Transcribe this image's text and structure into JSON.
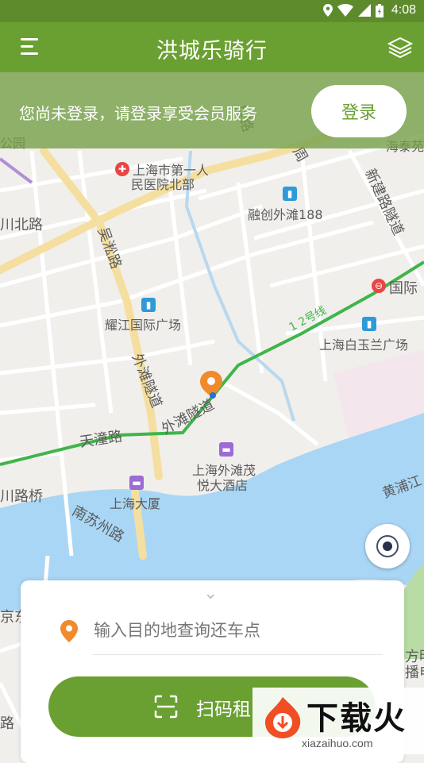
{
  "status_bar": {
    "time": "4:08"
  },
  "header": {
    "title": "洪城乐骑行",
    "menu_icon": "menu-icon",
    "layers_icon": "layers-icon"
  },
  "login_banner": {
    "message": "您尚未登录，请登录享受会员服务",
    "button_label": "登录"
  },
  "map": {
    "labels": [
      {
        "text": "公园",
        "name": "map-label-park"
      },
      {
        "text": "上海市第一人",
        "name": "map-label-hospital-1"
      },
      {
        "text": "民医院北部",
        "name": "map-label-hospital-2"
      },
      {
        "text": "融创外滩188",
        "name": "map-label-rongchuang"
      },
      {
        "text": "川北路",
        "name": "map-label-chuanbei-road"
      },
      {
        "text": "吴淞路",
        "name": "map-label-wusong-road"
      },
      {
        "text": "新建路隧道",
        "name": "map-label-xinjian-tunnel"
      },
      {
        "text": "国际",
        "name": "map-label-international"
      },
      {
        "text": "耀江国际广场",
        "name": "map-label-yaojiang"
      },
      {
        "text": "1 2号线",
        "name": "map-label-metro-line"
      },
      {
        "text": "上海白玉兰广场",
        "name": "map-label-white-magnolia"
      },
      {
        "text": "外滩隧道",
        "name": "map-label-bund-tunnel"
      },
      {
        "text": "外滩隧道",
        "name": "map-label-bund-tunnel-2"
      },
      {
        "text": "天潼路",
        "name": "map-label-tiantong-road"
      },
      {
        "text": "上海外滩茂",
        "name": "map-label-hotel-1"
      },
      {
        "text": "悦大酒店",
        "name": "map-label-hotel-2"
      },
      {
        "text": "川路桥",
        "name": "map-label-chuan-bridge"
      },
      {
        "text": "上海大厦",
        "name": "map-label-shanghai-mansions"
      },
      {
        "text": "黄浦江",
        "name": "map-label-huangpu-river"
      },
      {
        "text": "南苏州路",
        "name": "map-label-south-suzhou-road"
      },
      {
        "text": "海泰苑",
        "name": "map-label-haitai"
      },
      {
        "text": "京东",
        "name": "map-label-jingdong"
      },
      {
        "text": "方明",
        "name": "map-label-fangming"
      },
      {
        "text": "播电",
        "name": "map-label-bodian"
      },
      {
        "text": "路",
        "name": "map-label-road-edge"
      },
      {
        "text": "兵路",
        "name": "map-label-bing-road"
      },
      {
        "text": "周",
        "name": "map-label-zhou"
      }
    ]
  },
  "bottom_panel": {
    "destination_placeholder": "输入目的地查询还车点",
    "scan_label": "扫码租",
    "scan_icon": "scan-icon",
    "location_icon": "location-pin-icon"
  },
  "watermark": {
    "text": "下载火",
    "domain": "xiazaihuo.com"
  },
  "colors": {
    "primary": "#6aa031",
    "status_bar": "#5d8b2c",
    "river": "#a9d6f5",
    "pin": "#f08a2b"
  }
}
